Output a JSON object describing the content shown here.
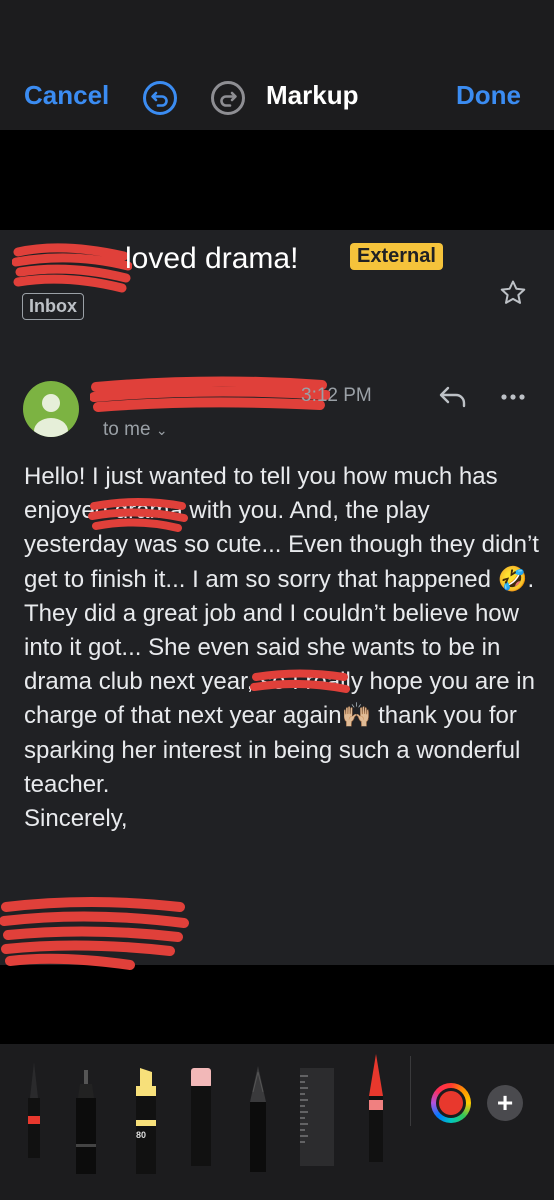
{
  "markup_bar": {
    "cancel_label": "Cancel",
    "title": "Markup",
    "done_label": "Done",
    "undo_icon": "undo-icon",
    "redo_icon": "redo-icon",
    "accent_color": "#3b8cf2"
  },
  "email": {
    "subject": "loved drama!",
    "external_badge": "External",
    "inbox_label": "Inbox",
    "time": "3:12 PM",
    "recipient": "to me",
    "body_paragraphs": [
      "Hello! I just wanted to tell you how much has enjoyed drama with you. And, the play yesterday was so cute... Even though they didn’t get to finish it... I am so sorry that happened 🤣. They did a great job and I couldn’t believe how into it got... She even said she wants to be in drama club next year, so I really hope you are in charge of that next year again🙌🏼 thank you for sparking her interest in being such a wonderful teacher.",
      "Sincerely,"
    ],
    "badge_color": "#f5c33b"
  },
  "tools": {
    "highlighter_label": "80",
    "selected_color": "#e8382d"
  }
}
